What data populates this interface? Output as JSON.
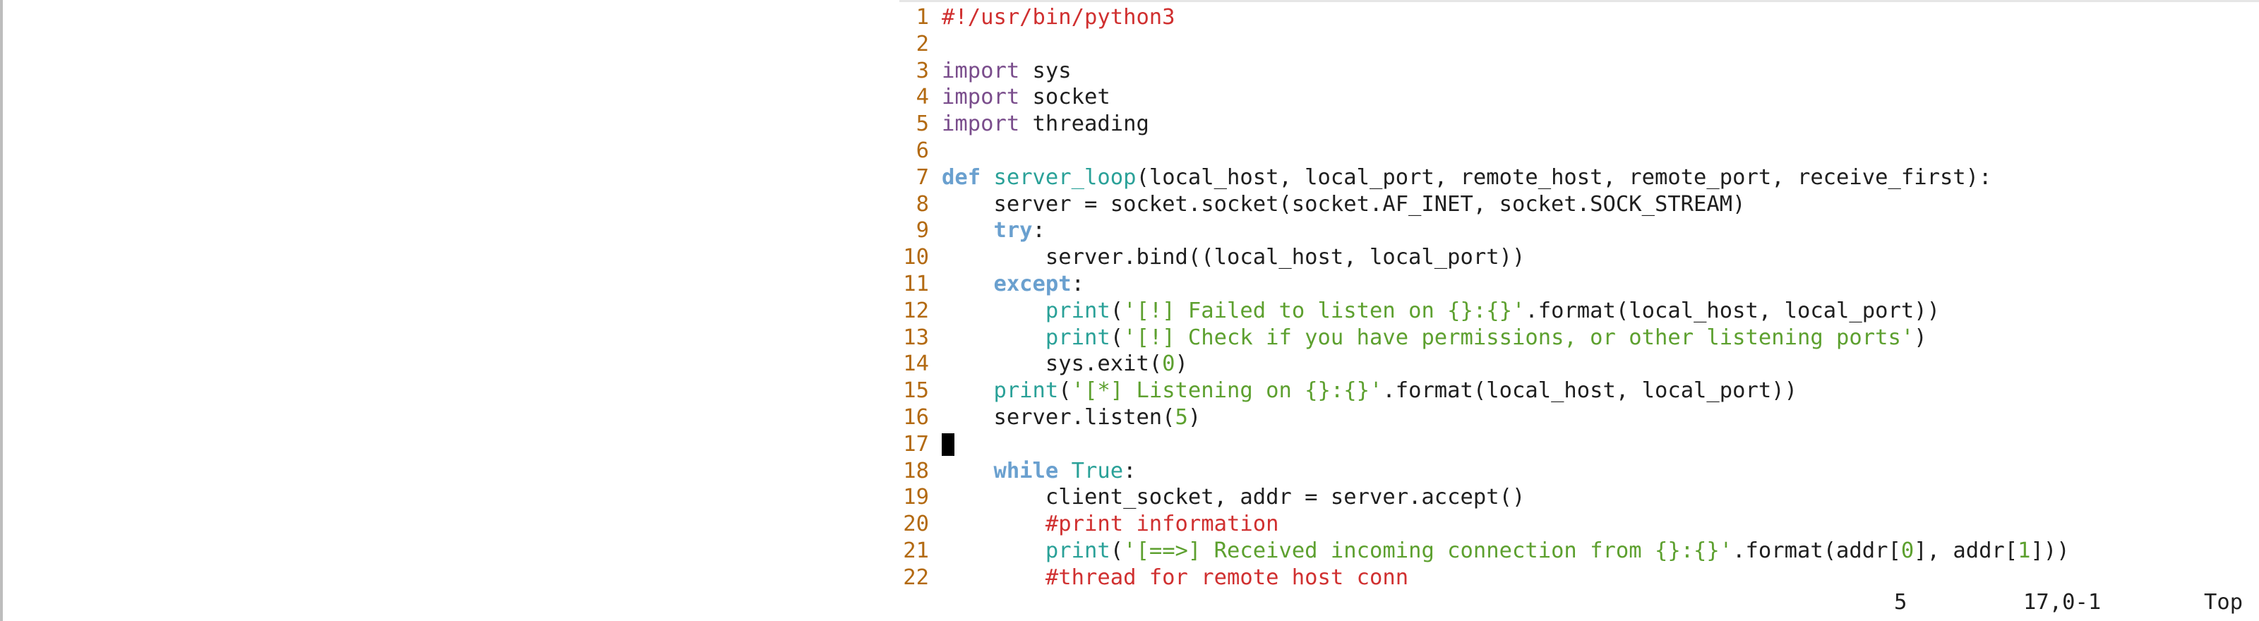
{
  "editor": {
    "lines": [
      {
        "num": "1",
        "tokens": [
          {
            "t": "#!/usr/bin/python3",
            "c": "shebang"
          }
        ]
      },
      {
        "num": "2",
        "tokens": []
      },
      {
        "num": "3",
        "tokens": [
          {
            "t": "import",
            "c": "kw"
          },
          {
            "t": " sys",
            "c": "plain"
          }
        ]
      },
      {
        "num": "4",
        "tokens": [
          {
            "t": "import",
            "c": "kw"
          },
          {
            "t": " socket",
            "c": "plain"
          }
        ]
      },
      {
        "num": "5",
        "tokens": [
          {
            "t": "import",
            "c": "kw"
          },
          {
            "t": " threading",
            "c": "plain"
          }
        ]
      },
      {
        "num": "6",
        "tokens": []
      },
      {
        "num": "7",
        "tokens": [
          {
            "t": "def",
            "c": "kwb"
          },
          {
            "t": " ",
            "c": "plain"
          },
          {
            "t": "server_loop",
            "c": "fn"
          },
          {
            "t": "(local_host, local_port, remote_host, remote_port, receive_first):",
            "c": "plain"
          }
        ]
      },
      {
        "num": "8",
        "tokens": [
          {
            "t": "    server = socket.socket(socket.AF_INET, socket.SOCK_STREAM)",
            "c": "plain"
          }
        ]
      },
      {
        "num": "9",
        "tokens": [
          {
            "t": "    ",
            "c": "plain"
          },
          {
            "t": "try",
            "c": "kwb"
          },
          {
            "t": ":",
            "c": "plain"
          }
        ]
      },
      {
        "num": "10",
        "tokens": [
          {
            "t": "        server.bind((local_host, local_port))",
            "c": "plain"
          }
        ]
      },
      {
        "num": "11",
        "tokens": [
          {
            "t": "    ",
            "c": "plain"
          },
          {
            "t": "except",
            "c": "kwb"
          },
          {
            "t": ":",
            "c": "plain"
          }
        ]
      },
      {
        "num": "12",
        "tokens": [
          {
            "t": "        ",
            "c": "plain"
          },
          {
            "t": "print",
            "c": "fn"
          },
          {
            "t": "(",
            "c": "plain"
          },
          {
            "t": "'[!] Failed to listen on {}:{}'",
            "c": "str"
          },
          {
            "t": ".format(local_host, local_port))",
            "c": "plain"
          }
        ]
      },
      {
        "num": "13",
        "tokens": [
          {
            "t": "        ",
            "c": "plain"
          },
          {
            "t": "print",
            "c": "fn"
          },
          {
            "t": "(",
            "c": "plain"
          },
          {
            "t": "'[!] Check if you have permissions, or other listening ports'",
            "c": "str"
          },
          {
            "t": ")",
            "c": "plain"
          }
        ]
      },
      {
        "num": "14",
        "tokens": [
          {
            "t": "        sys.exit(",
            "c": "plain"
          },
          {
            "t": "0",
            "c": "num"
          },
          {
            "t": ")",
            "c": "plain"
          }
        ]
      },
      {
        "num": "15",
        "tokens": [
          {
            "t": "    ",
            "c": "plain"
          },
          {
            "t": "print",
            "c": "fn"
          },
          {
            "t": "(",
            "c": "plain"
          },
          {
            "t": "'[*] Listening on {}:{}'",
            "c": "str"
          },
          {
            "t": ".format(local_host, local_port))",
            "c": "plain"
          }
        ]
      },
      {
        "num": "16",
        "tokens": [
          {
            "t": "    server.listen(",
            "c": "plain"
          },
          {
            "t": "5",
            "c": "num"
          },
          {
            "t": ")",
            "c": "plain"
          }
        ]
      },
      {
        "num": "17",
        "tokens": []
      },
      {
        "num": "18",
        "tokens": [
          {
            "t": "    ",
            "c": "plain"
          },
          {
            "t": "while",
            "c": "kwb"
          },
          {
            "t": " ",
            "c": "plain"
          },
          {
            "t": "True",
            "c": "fn"
          },
          {
            "t": ":",
            "c": "plain"
          }
        ]
      },
      {
        "num": "19",
        "tokens": [
          {
            "t": "        client_socket, addr = server.accept()",
            "c": "plain"
          }
        ]
      },
      {
        "num": "20",
        "tokens": [
          {
            "t": "        ",
            "c": "plain"
          },
          {
            "t": "#print information",
            "c": "cmt"
          }
        ]
      },
      {
        "num": "21",
        "tokens": [
          {
            "t": "        ",
            "c": "plain"
          },
          {
            "t": "print",
            "c": "fn"
          },
          {
            "t": "(",
            "c": "plain"
          },
          {
            "t": "'[==>] Received incoming connection from {}:{}'",
            "c": "str"
          },
          {
            "t": ".format(addr[",
            "c": "plain"
          },
          {
            "t": "0",
            "c": "num"
          },
          {
            "t": "], addr[",
            "c": "plain"
          },
          {
            "t": "1",
            "c": "num"
          },
          {
            "t": "]))",
            "c": "plain"
          }
        ]
      },
      {
        "num": "22",
        "tokens": [
          {
            "t": "        ",
            "c": "plain"
          },
          {
            "t": "#thread for remote host conn",
            "c": "cmt"
          }
        ]
      }
    ],
    "cursor_line": "17"
  },
  "status": {
    "count": "5",
    "position": "17,0-1",
    "scroll": "Top"
  },
  "colors": {
    "line_number": "#b36a12",
    "keyword_import": "#7a4d8c",
    "keyword_control": "#6aa0cf",
    "function": "#2aa198",
    "string": "#5da02f",
    "comment": "#d03030",
    "text": "#1f1f1f",
    "background": "#ffffff"
  }
}
